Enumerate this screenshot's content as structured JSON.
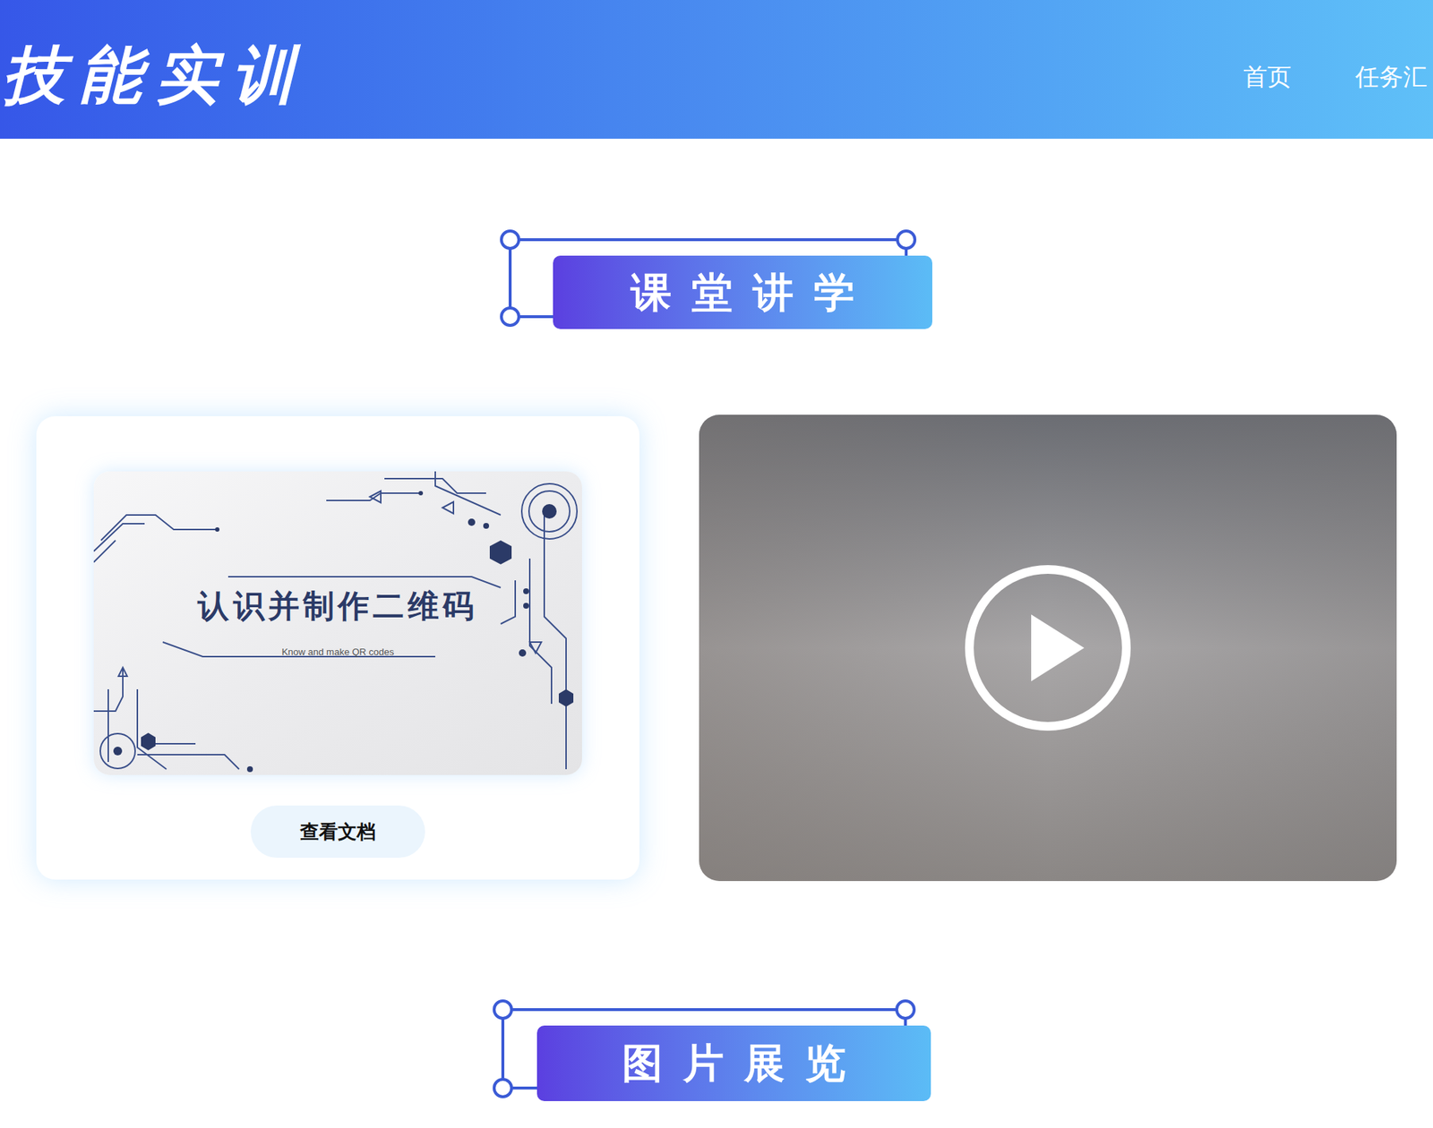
{
  "header": {
    "logo": "技能实训",
    "nav": [
      {
        "label": "首页"
      },
      {
        "label": "任务汇"
      }
    ]
  },
  "lecture": {
    "title": "课堂讲学",
    "document": {
      "title": "认识并制作二维码",
      "subtitle": "Know and make QR codes",
      "button": "查看文档"
    }
  },
  "gallery": {
    "title": "图片展览"
  }
}
